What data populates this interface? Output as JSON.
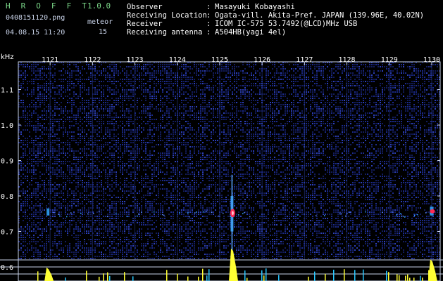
{
  "app": {
    "logo": "H R O F F T",
    "version": "1.0.0"
  },
  "file": {
    "name": "0408151120.png",
    "datetime": "04.08.15 11:20"
  },
  "meteor": {
    "label": "meteor",
    "count": "15"
  },
  "station": [
    {
      "label": "Observer",
      "value": "Masayuki Kobayashi"
    },
    {
      "label": "Receiving Location",
      "value": "Ogata-vill. Akita-Pref. JAPAN (139.96E, 40.02N)"
    },
    {
      "label": "Receiver",
      "value": "ICOM IC-575 53.7492(@LCD)MHz USB"
    },
    {
      "label": "Receiving antenna",
      "value": "A504HB(yagi 4el)"
    }
  ],
  "colors": {
    "background": "#000000",
    "header_text": "#ffffff",
    "logo": "#7cd88a",
    "grid": "#c8d2e8",
    "noise": "#1b2a8a",
    "echo": "#2fa9ff",
    "echo_core": "#ff2a55",
    "level": "#ffff33"
  },
  "chart_data": {
    "type": "heatmap",
    "ylabel": "kHz",
    "x_ticks": [
      "1121",
      "1122",
      "1123",
      "1124",
      "1125",
      "1126",
      "1127",
      "1128",
      "1129",
      "1130"
    ],
    "y_ticks": [
      "1.1",
      "1.0",
      "0.9",
      "0.8",
      "0.7",
      "0.6"
    ],
    "x_range": [
      1120.25,
      1130.2
    ],
    "y_range": [
      0.6,
      1.2
    ],
    "echoes": [
      {
        "time": 1125.29,
        "freq_low": 0.7,
        "freq_high": 0.8,
        "strength": "strong"
      },
      {
        "time": 1130.0,
        "freq_low": 0.745,
        "freq_high": 0.77,
        "strength": "medium"
      },
      {
        "time": 1120.95,
        "freq_low": 0.745,
        "freq_high": 0.765,
        "strength": "weak"
      }
    ],
    "level_peaks": [
      {
        "time": 1125.3,
        "level": 1.0
      },
      {
        "time": 1130.0,
        "level": 0.6
      },
      {
        "time": 1120.95,
        "level": 0.3
      }
    ]
  }
}
